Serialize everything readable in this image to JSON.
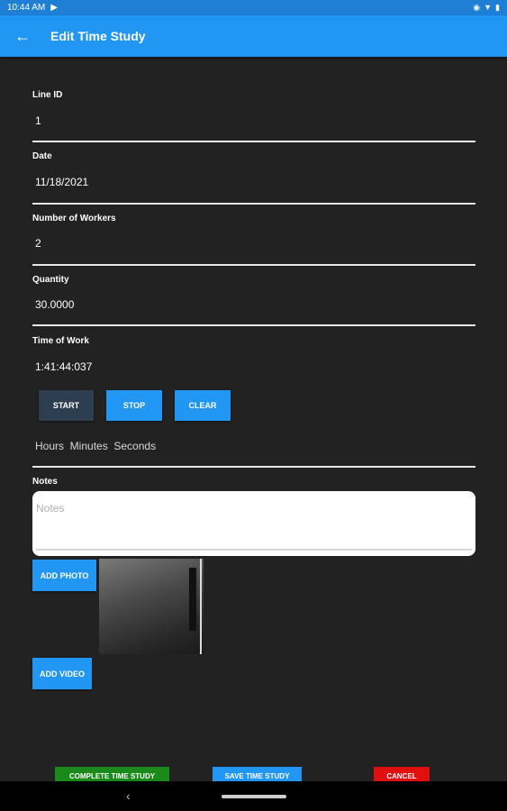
{
  "status_bar": {
    "time": "10:44 AM",
    "icons": [
      "play-icon",
      "eye-icon",
      "wifi-icon",
      "battery-icon"
    ]
  },
  "app_bar": {
    "title": "Edit Time Study",
    "back_icon": "arrow-left-icon"
  },
  "fields": {
    "line_id": {
      "label": "Line ID",
      "value": "1"
    },
    "date": {
      "label": "Date",
      "value": "11/18/2021"
    },
    "workers": {
      "label": "Number of Workers",
      "value": "2"
    },
    "quantity": {
      "label": "Quantity",
      "value": "30.0000"
    },
    "time_of_work": {
      "label": "Time of Work",
      "value": "1:41:44:037"
    }
  },
  "timer_buttons": {
    "start": "START",
    "stop": "STOP",
    "clear": "CLEAR"
  },
  "time_units": "Hours  Minutes  Seconds",
  "notes": {
    "label": "Notes",
    "placeholder": "Notes"
  },
  "media": {
    "add_photo": "ADD PHOTO",
    "add_video": "ADD VIDEO"
  },
  "actions": {
    "complete": "COMPLETE TIME STUDY",
    "save": "SAVE TIME STUDY",
    "cancel": "CANCEL"
  },
  "colors": {
    "accent": "#2196f3",
    "background": "#222222",
    "complete": "#1a8a1a",
    "cancel": "#e01010",
    "start_button": "#2c3e50"
  }
}
